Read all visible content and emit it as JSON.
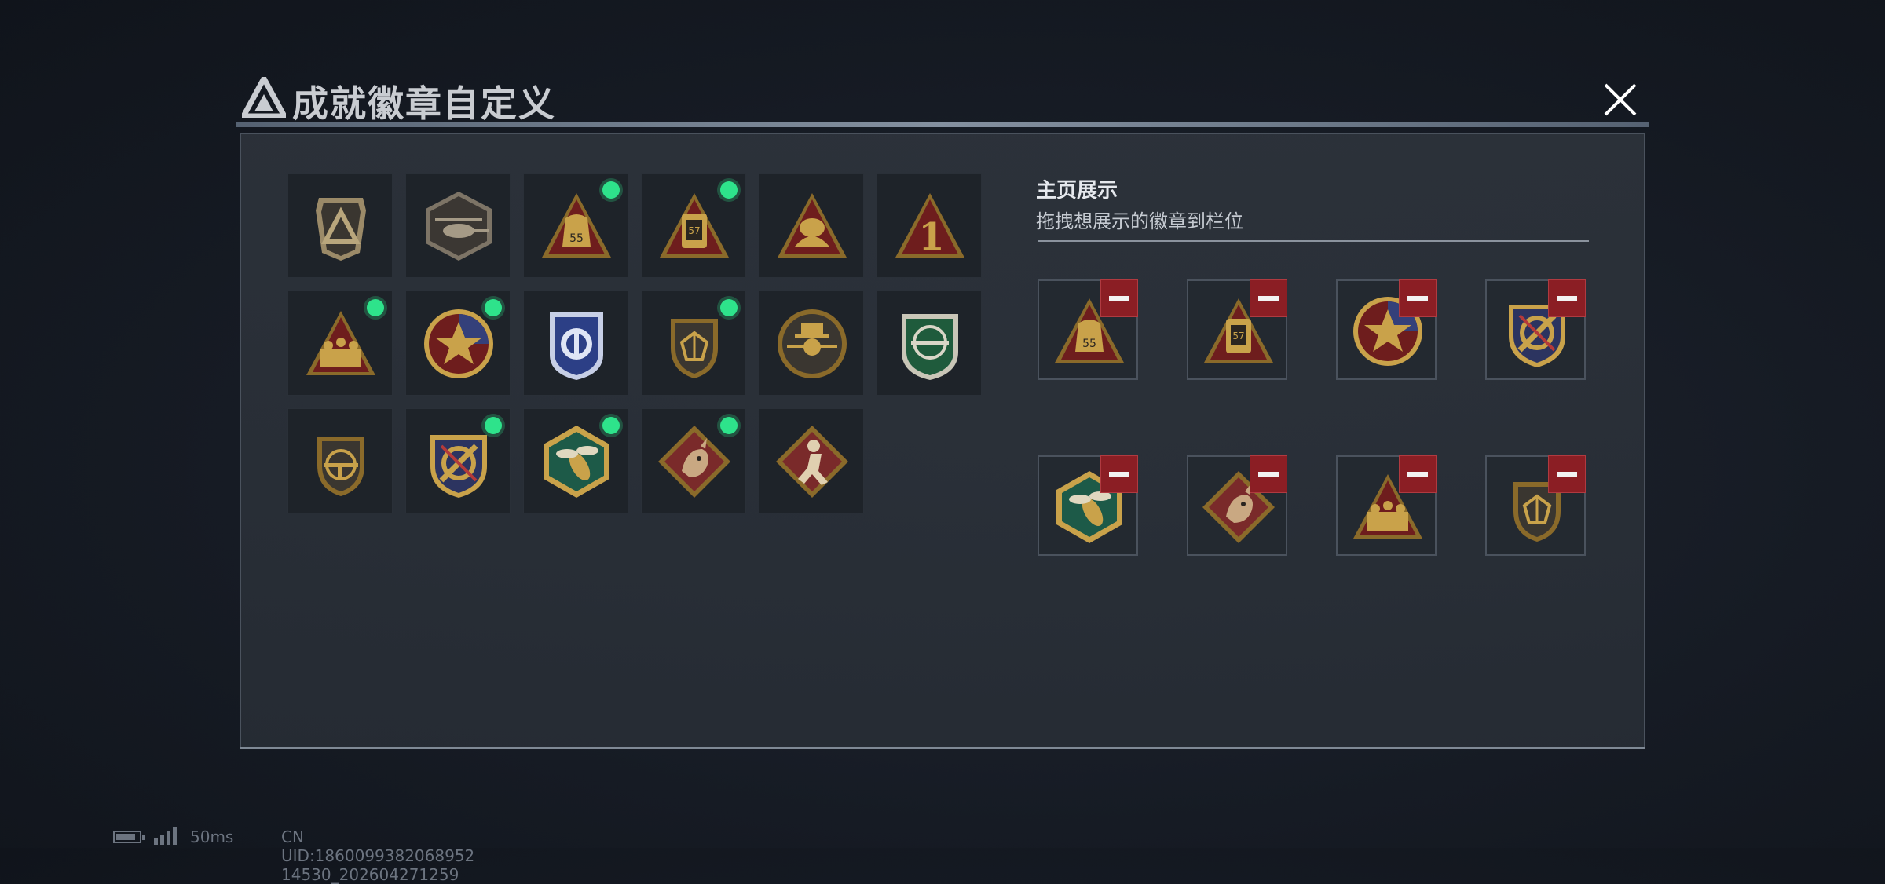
{
  "window": {
    "title": "成就徽章自定义",
    "close_icon": "close-icon"
  },
  "colors": {
    "panel_bg": "#2d333b",
    "new_dot": "#2ee38b",
    "remove_button": "#8b1e24",
    "gold": "#c9a24a"
  },
  "collection": {
    "badges": [
      {
        "name": "triangle-logo-badge",
        "new": false
      },
      {
        "name": "helicopter-badge",
        "new": false
      },
      {
        "name": "bag-55-badge",
        "new": true
      },
      {
        "name": "canister-57-badge",
        "new": true
      },
      {
        "name": "tent-badge",
        "new": false
      },
      {
        "name": "number-one-badge",
        "new": false
      },
      {
        "name": "squad-badge",
        "new": true
      },
      {
        "name": "star-shield-badge",
        "new": true
      },
      {
        "name": "blue-emblem-badge",
        "new": false
      },
      {
        "name": "gem-shield-badge",
        "new": true
      },
      {
        "name": "agent-badge",
        "new": false
      },
      {
        "name": "green-rifle-badge",
        "new": false
      },
      {
        "name": "rifle-shield-badge",
        "new": false
      },
      {
        "name": "crossed-sword-badge",
        "new": true
      },
      {
        "name": "hornet-badge",
        "new": true
      },
      {
        "name": "dragon-badge",
        "new": true
      },
      {
        "name": "runner-badge",
        "new": false
      }
    ]
  },
  "showcase": {
    "title": "主页展示",
    "subtitle": "拖拽想展示的徽章到栏位",
    "slots": [
      {
        "badge": "bag-55-badge"
      },
      {
        "badge": "canister-57-badge"
      },
      {
        "badge": "star-shield-badge"
      },
      {
        "badge": "crossed-sword-badge"
      },
      {
        "badge": "hornet-badge"
      },
      {
        "badge": "dragon-badge"
      },
      {
        "badge": "squad-badge"
      },
      {
        "badge": "gem-shield-badge"
      }
    ]
  },
  "status": {
    "latency": "50ms",
    "uid": "CN UID:1860099382068952 14530_202604271259"
  }
}
